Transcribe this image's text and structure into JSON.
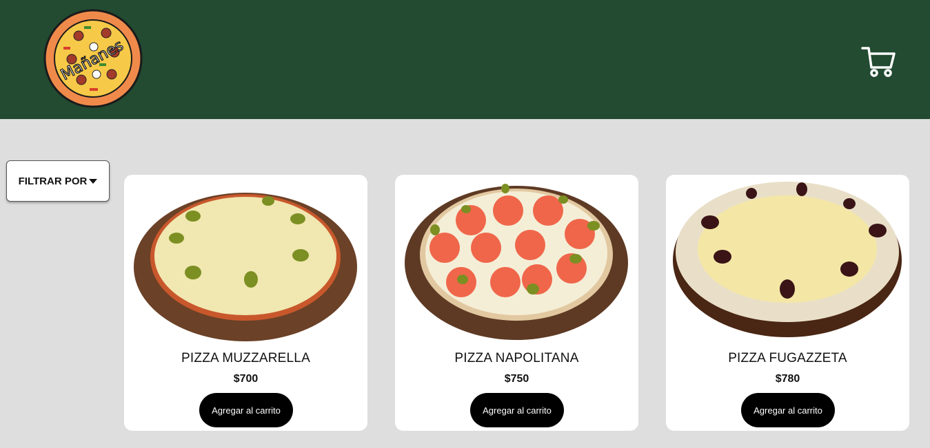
{
  "header": {
    "logo_text": "Mañanes",
    "cart_icon": "shopping-cart-icon",
    "background": "#224b31"
  },
  "filter": {
    "label": "FILTRAR POR",
    "icon": "caret-down-icon"
  },
  "products": [
    {
      "name": "PIZZA MUZZARELLA",
      "price": "$700",
      "button": "Agregar al carrito",
      "image": "pizza-muzzarella-image"
    },
    {
      "name": "PIZZA NAPOLITANA",
      "price": "$750",
      "button": "Agregar al carrito",
      "image": "pizza-napolitana-image"
    },
    {
      "name": "PIZZA FUGAZZETA",
      "price": "$780",
      "button": "Agregar al carrito",
      "image": "pizza-fugazzeta-image"
    }
  ],
  "colors": {
    "page_background": "#dedede",
    "card_background": "#ffffff",
    "button_background": "#000000"
  }
}
